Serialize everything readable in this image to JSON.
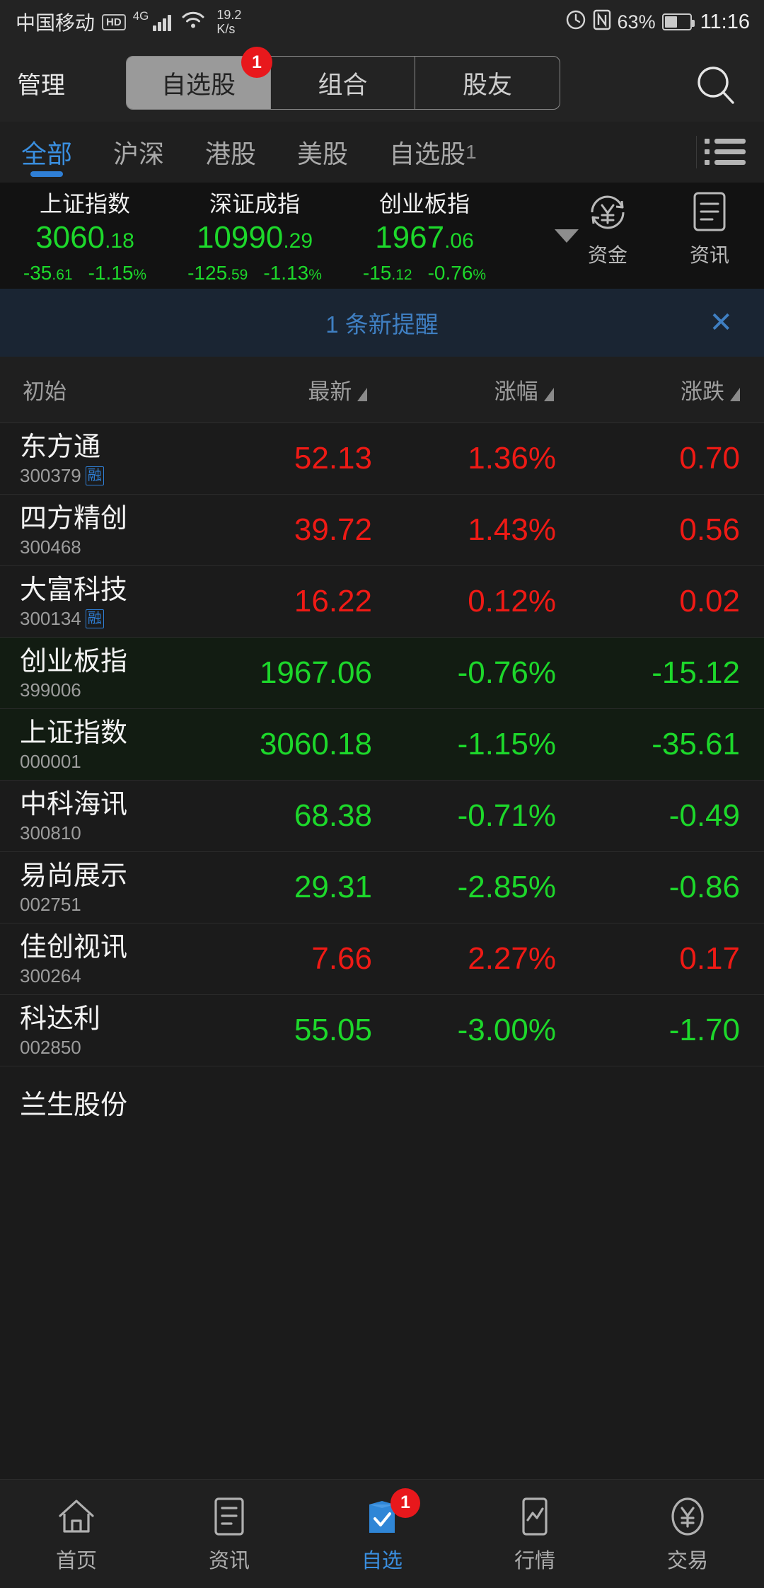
{
  "statusbar": {
    "carrier": "中国移动",
    "hd": "HD",
    "network": "4G",
    "speed_value": "19.2",
    "speed_unit": "K/s",
    "battery_percent": "63%",
    "clock": "11:16",
    "icons": [
      "alarm-icon",
      "nfc-icon",
      "battery-icon"
    ]
  },
  "topbar": {
    "manage_label": "管理",
    "segments": [
      {
        "label": "自选股",
        "active": true,
        "badge": "1"
      },
      {
        "label": "组合",
        "active": false,
        "badge": ""
      },
      {
        "label": "股友",
        "active": false,
        "badge": ""
      }
    ],
    "search_icon": "search-icon"
  },
  "tabs": {
    "items": [
      {
        "label": "全部",
        "active": true
      },
      {
        "label": "沪深",
        "active": false
      },
      {
        "label": "港股",
        "active": false
      },
      {
        "label": "美股",
        "active": false
      }
    ],
    "custom_tab": "自选股",
    "custom_tab_num": "1",
    "list_icon": "list-view-icon"
  },
  "indexes": [
    {
      "name": "上证指数",
      "value_int": "3060",
      "value_dec": ".18",
      "change_int": "-35",
      "change_dec": ".61",
      "pct": "-1.15",
      "pct_sym": "%",
      "direction": "down"
    },
    {
      "name": "深证成指",
      "value_int": "10990",
      "value_dec": ".29",
      "change_int": "-125",
      "change_dec": ".59",
      "pct": "-1.13",
      "pct_sym": "%",
      "direction": "down"
    },
    {
      "name": "创业板指",
      "value_int": "1967",
      "value_dec": ".06",
      "change_int": "-15",
      "change_dec": ".12",
      "pct": "-0.76",
      "pct_sym": "%",
      "direction": "down"
    }
  ],
  "index_tools": [
    {
      "label": "资金",
      "icon": "funds-yuan-icon"
    },
    {
      "label": "资讯",
      "icon": "news-document-icon"
    }
  ],
  "notification": {
    "text": "1 条新提醒",
    "close_icon": "close-icon"
  },
  "columns": {
    "name": "初始",
    "price": "最新",
    "pct": "涨幅",
    "change": "涨跌"
  },
  "stocks": [
    {
      "name": "东方通",
      "code": "300379",
      "flag": "融",
      "price": "52.13",
      "pct": "1.36%",
      "change": "0.70",
      "direction": "up",
      "tint": false
    },
    {
      "name": "四方精创",
      "code": "300468",
      "flag": "",
      "price": "39.72",
      "pct": "1.43%",
      "change": "0.56",
      "direction": "up",
      "tint": false
    },
    {
      "name": "大富科技",
      "code": "300134",
      "flag": "融",
      "price": "16.22",
      "pct": "0.12%",
      "change": "0.02",
      "direction": "up",
      "tint": false
    },
    {
      "name": "创业板指",
      "code": "399006",
      "flag": "",
      "price": "1967.06",
      "pct": "-0.76%",
      "change": "-15.12",
      "direction": "down",
      "tint": true
    },
    {
      "name": "上证指数",
      "code": "000001",
      "flag": "",
      "price": "3060.18",
      "pct": "-1.15%",
      "change": "-35.61",
      "direction": "down",
      "tint": true
    },
    {
      "name": "中科海讯",
      "code": "300810",
      "flag": "",
      "price": "68.38",
      "pct": "-0.71%",
      "change": "-0.49",
      "direction": "down",
      "tint": false
    },
    {
      "name": "易尚展示",
      "code": "002751",
      "flag": "",
      "price": "29.31",
      "pct": "-2.85%",
      "change": "-0.86",
      "direction": "down",
      "tint": false
    },
    {
      "name": "佳创视讯",
      "code": "300264",
      "flag": "",
      "price": "7.66",
      "pct": "2.27%",
      "change": "0.17",
      "direction": "up",
      "tint": false
    },
    {
      "name": "科达利",
      "code": "002850",
      "flag": "",
      "price": "55.05",
      "pct": "-3.00%",
      "change": "-1.70",
      "direction": "down",
      "tint": false
    }
  ],
  "partial_row": {
    "name": "兰生股份"
  },
  "bottomnav": [
    {
      "label": "首页",
      "icon": "home-icon",
      "active": false,
      "badge": ""
    },
    {
      "label": "资讯",
      "icon": "news-icon",
      "active": false,
      "badge": ""
    },
    {
      "label": "自选",
      "icon": "watchlist-icon",
      "active": true,
      "badge": "1"
    },
    {
      "label": "行情",
      "icon": "quotes-icon",
      "active": false,
      "badge": ""
    },
    {
      "label": "交易",
      "icon": "trade-icon",
      "active": false,
      "badge": ""
    }
  ],
  "colors": {
    "up": "#ef1a15",
    "down": "#1dd82b",
    "accent": "#3a8fe0",
    "badge": "#e8181c"
  }
}
